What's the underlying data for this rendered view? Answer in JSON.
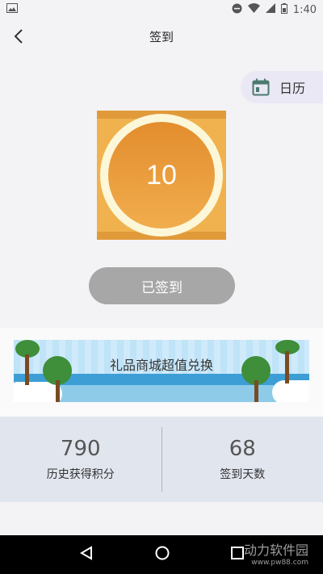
{
  "status_bar": {
    "time": "1:40"
  },
  "header": {
    "title": "签到"
  },
  "calendar": {
    "label": "日历"
  },
  "badge": {
    "count": "10"
  },
  "sign_button": {
    "label": "已签到"
  },
  "banner": {
    "text": "礼品商城超值兑换"
  },
  "stats": [
    {
      "value": "790",
      "label": "历史获得积分"
    },
    {
      "value": "68",
      "label": "签到天数"
    }
  ],
  "watermark": {
    "text": "动力软件园",
    "url": "www.pw88.com"
  },
  "colors": {
    "accent_orange": "#f0b24e",
    "signed_gray": "#a7a7a7",
    "stats_bg": "#e1e5ee"
  }
}
